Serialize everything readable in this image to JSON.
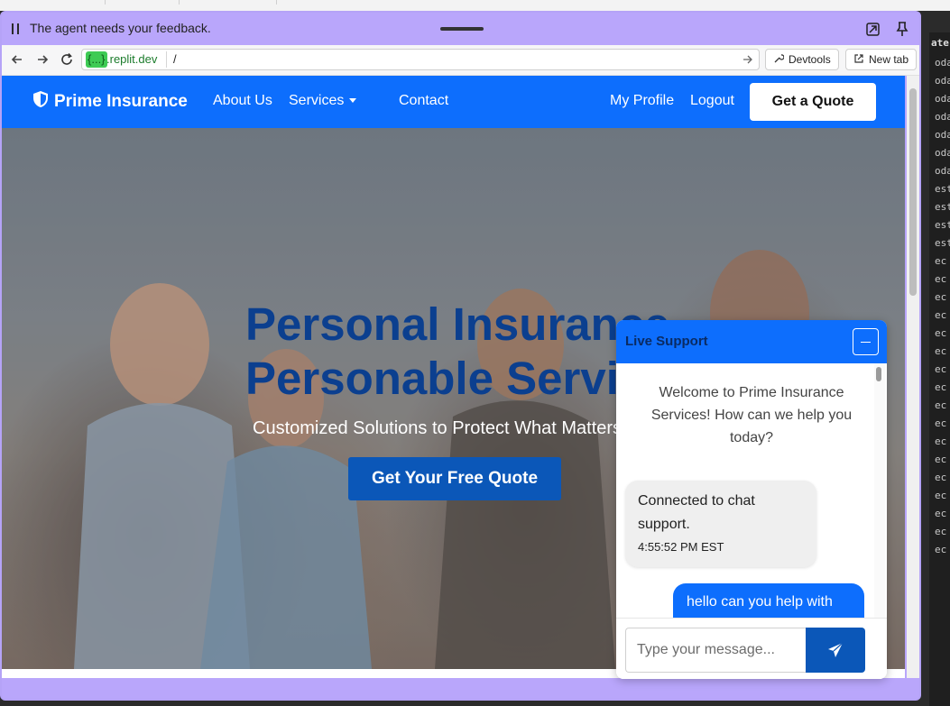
{
  "overlay": {
    "feedback_text": "The agent needs your feedback."
  },
  "browser": {
    "domain_pill": "{...}",
    "domain": ".replit.dev",
    "path": "/",
    "devtools_label": "Devtools",
    "newtab_label": "New tab"
  },
  "site": {
    "brand": "Prime Insurance",
    "nav": {
      "about": "About Us",
      "services": "Services",
      "contact": "Contact",
      "profile": "My Profile",
      "logout": "Logout",
      "quote": "Get a Quote"
    },
    "hero": {
      "title_line1": "Personal Insurance",
      "title_line2": "Personable Service",
      "subtitle": "Customized Solutions to Protect What Matters",
      "cta": "Get Your Free Quote"
    }
  },
  "chat": {
    "title": "Live Support",
    "welcome": "Welcome to Prime Insurance Services! How can we help you today?",
    "messages": [
      {
        "from": "agent",
        "text": "Connected to chat support.",
        "time": "4:55:52 PM EST"
      },
      {
        "from": "user",
        "text": "hello can you help with"
      }
    ],
    "input_placeholder": "Type your message..."
  },
  "side_log": {
    "header": "ate",
    "lines": [
      "oda",
      "oda",
      "oda",
      "oda",
      "oda",
      "oda",
      "oda",
      "est",
      "est",
      "est",
      "est",
      "ec",
      "ec",
      "ec",
      "ec",
      "ec",
      "ec",
      "ec",
      "ec",
      "ec",
      "ec",
      "ec",
      "ec",
      "ec",
      "ec",
      "ec",
      "ec",
      "ec"
    ]
  },
  "colors": {
    "frame_purple": "#b9a6fb",
    "brand_blue": "#0d6efd",
    "hero_title": "#0b3f8f",
    "cta_blue": "#0b57b8"
  }
}
